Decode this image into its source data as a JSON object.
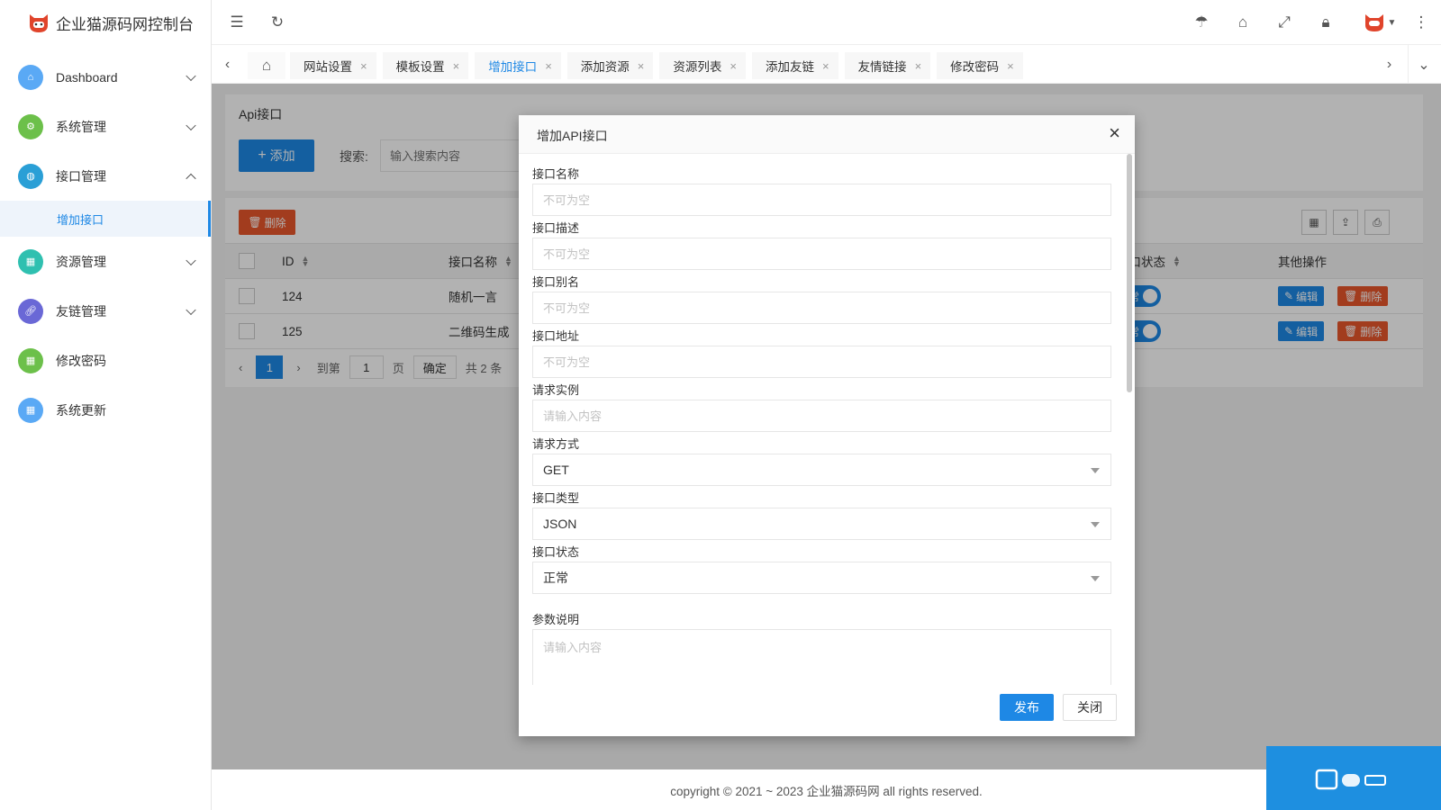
{
  "app": {
    "title": "企业猫源码网控制台"
  },
  "sidebar": {
    "items": [
      {
        "label": "Dashboard",
        "color": "#5aa9f5",
        "arrow": "down"
      },
      {
        "label": "系统管理",
        "color": "#6cc04a",
        "arrow": "down"
      },
      {
        "label": "接口管理",
        "color": "#2a9fd6",
        "arrow": "up"
      },
      {
        "label": "资源管理",
        "color": "#2fc0b0",
        "arrow": "down"
      },
      {
        "label": "友链管理",
        "color": "#6a68d6",
        "arrow": "down"
      },
      {
        "label": "修改密码",
        "color": "#6cc04a"
      },
      {
        "label": "系统更新",
        "color": "#5aa9f5"
      }
    ],
    "submenu_active": "增加接口"
  },
  "tabs": [
    {
      "label": "网站设置",
      "close": "×"
    },
    {
      "label": "模板设置",
      "close": "×"
    },
    {
      "label": "增加接口",
      "close": "×"
    },
    {
      "label": "添加资源",
      "close": "×"
    },
    {
      "label": "资源列表",
      "close": "×"
    },
    {
      "label": "添加友链",
      "close": "×"
    },
    {
      "label": "友情链接",
      "close": "×"
    },
    {
      "label": "修改密码",
      "close": "×"
    }
  ],
  "page": {
    "card_title": "Api接口",
    "add_button": "添加",
    "search_label": "搜索:",
    "search_placeholder": "输入搜索内容",
    "delete_button": "删除"
  },
  "table": {
    "headers": {
      "id": "ID",
      "name": "接口名称",
      "status": "接口状态",
      "ops": "其他操作"
    },
    "rows": [
      {
        "id": "124",
        "name": "随机一言",
        "status": "正常",
        "edit": "编辑",
        "del": "删除"
      },
      {
        "id": "125",
        "name": "二维码生成",
        "status": "正常",
        "edit": "编辑",
        "del": "删除"
      }
    ]
  },
  "pager": {
    "page": "1",
    "goto": "到第",
    "page_input": "1",
    "page_unit": "页",
    "ok": "确定",
    "total": "共 2 条"
  },
  "footer": {
    "text": "copyright © 2021 ~ 2023 企业猫源码网 all rights reserved."
  },
  "modal": {
    "title": "增加API接口",
    "close": "×",
    "fields": {
      "name": {
        "label": "接口名称",
        "placeholder": "不可为空"
      },
      "desc": {
        "label": "接口描述",
        "placeholder": "不可为空"
      },
      "alias": {
        "label": "接口别名",
        "placeholder": "不可为空"
      },
      "url": {
        "label": "接口地址",
        "placeholder": "不可为空"
      },
      "example": {
        "label": "请求实例",
        "placeholder": "请输入内容"
      },
      "method": {
        "label": "请求方式",
        "value": "GET"
      },
      "type": {
        "label": "接口类型",
        "value": "JSON"
      },
      "status": {
        "label": "接口状态",
        "value": "正常"
      },
      "params": {
        "label": "参数说明",
        "placeholder": "请输入内容"
      }
    },
    "publish": "发布",
    "close_button": "关闭"
  },
  "colors": {
    "primary": "#1e88e5",
    "danger": "#e8572c"
  }
}
